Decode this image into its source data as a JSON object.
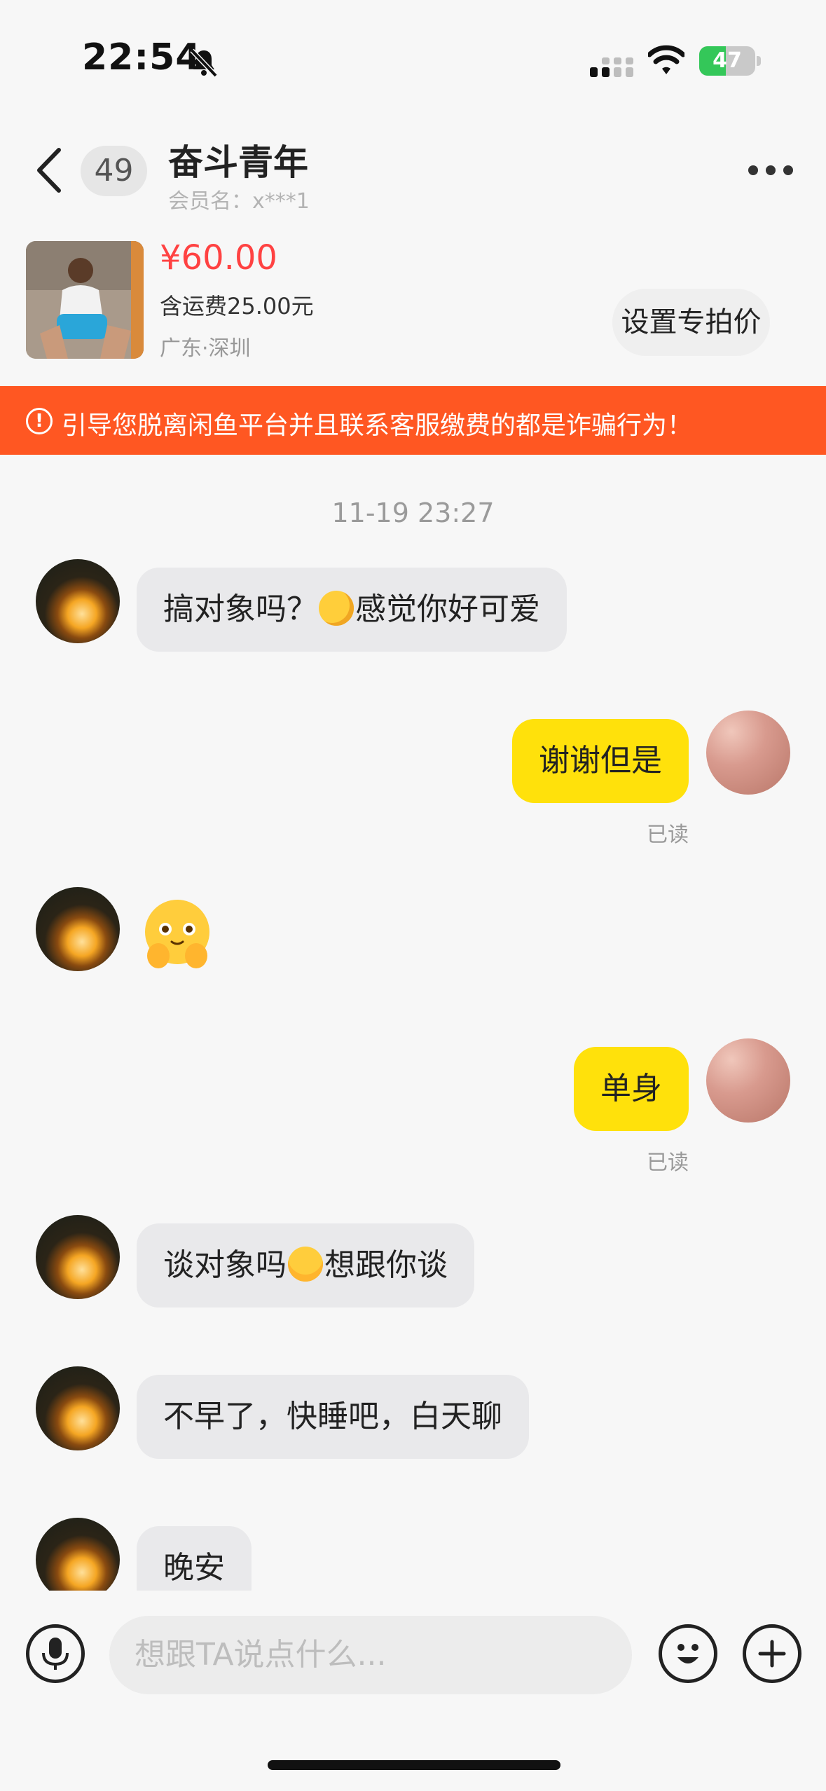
{
  "status_bar": {
    "time": "22:54",
    "battery": "47",
    "battery_level": 0.47
  },
  "header": {
    "unread_count": "49",
    "title": "奋斗青年",
    "member": "会员名：x***1"
  },
  "product": {
    "price": "¥60.00",
    "shipping": "含运费25.00元",
    "location": "广东·深圳",
    "action_label": "设置专拍价"
  },
  "warning": {
    "icon": "!",
    "text": "引导您脱离闲鱼平台并且联系客服缴费的都是诈骗行为！"
  },
  "chat": {
    "timestamp": "11-19 23:27",
    "messages": [
      {
        "sender": "them",
        "parts": [
          "搞对象吗？",
          "感觉你好可爱"
        ]
      },
      {
        "sender": "me",
        "text": "谢谢但是",
        "status": "已读"
      },
      {
        "sender": "them",
        "type": "emoji"
      },
      {
        "sender": "me",
        "text": "单身",
        "status": "已读"
      },
      {
        "sender": "them",
        "parts": [
          "谈对象吗",
          "想跟你谈"
        ]
      },
      {
        "sender": "them",
        "text": "不早了，快睡吧，白天聊"
      },
      {
        "sender": "them",
        "text": "晚安"
      }
    ]
  },
  "input_bar": {
    "placeholder": "想跟TA说点什么..."
  },
  "colors": {
    "accent_yellow": "#ffe10b",
    "warning_orange": "#ff5722",
    "price_red": "#ff4242"
  }
}
